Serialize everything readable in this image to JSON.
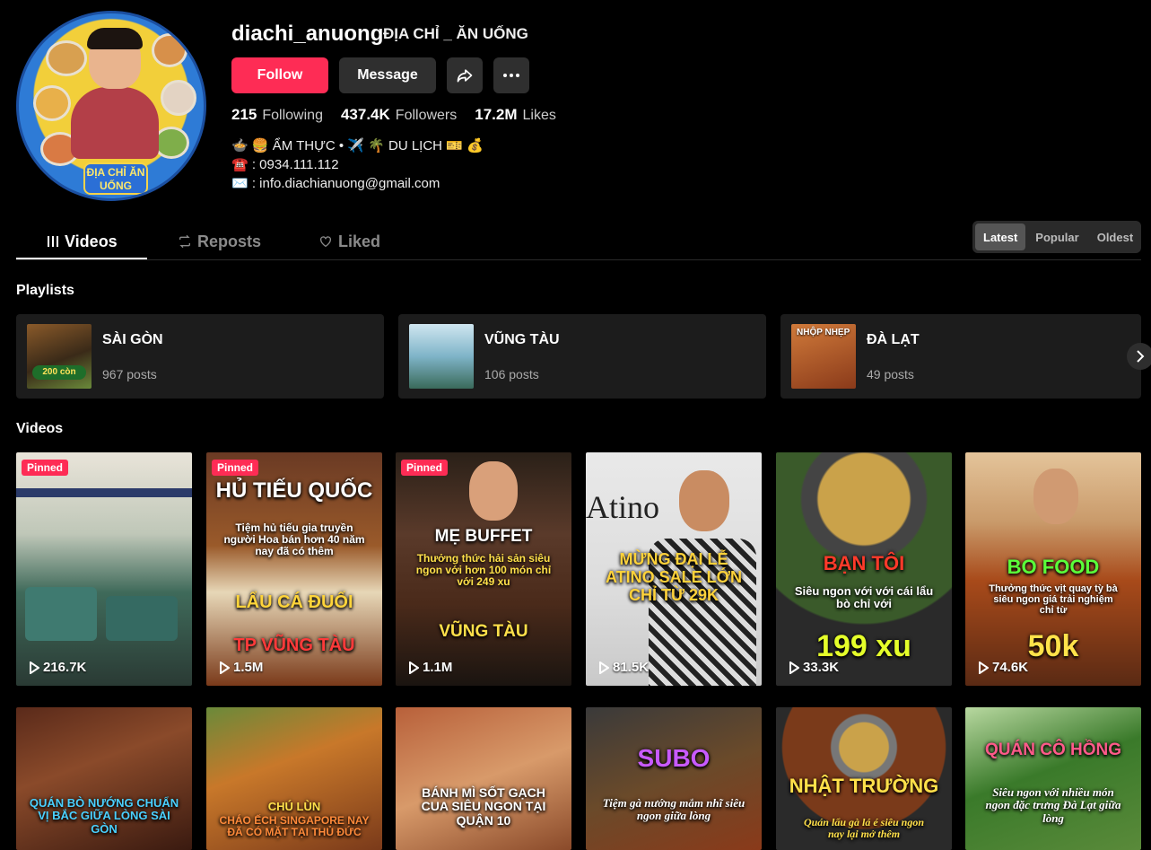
{
  "profile": {
    "username": "diachi_anuong",
    "nickname": "ĐỊA CHỈ _ ĂN UỐNG",
    "avatar_text": "ĐỊA CHỈ ĂN UỐNG",
    "follow_label": "Follow",
    "message_label": "Message",
    "share_icon": "share-icon",
    "more_icon": "more-icon"
  },
  "stats": {
    "following_value": "215",
    "following_label": "Following",
    "followers_value": "437.4K",
    "followers_label": "Followers",
    "likes_value": "17.2M",
    "likes_label": "Likes"
  },
  "bio": {
    "line1": "🍲 🍔 ẨM THỰC • ✈️ 🌴 DU LỊCH 🎫 💰",
    "line2": "☎️ : 0934.111.112",
    "line3": "✉️ : info.diachianuong@gmail.com"
  },
  "tabs": {
    "videos": "Videos",
    "reposts": "Reposts",
    "liked": "Liked"
  },
  "sort": {
    "latest": "Latest",
    "popular": "Popular",
    "oldest": "Oldest"
  },
  "sections": {
    "playlists": "Playlists",
    "videos": "Videos"
  },
  "playlists": [
    {
      "name": "SÀI GÒN",
      "count": "967 posts",
      "thumb_text": "200 còn"
    },
    {
      "name": "VŨNG TÀU",
      "count": "106 posts",
      "thumb_text": ""
    },
    {
      "name": "ĐÀ LẠT",
      "count": "49 posts",
      "thumb_text": "NHỘP NHẸP"
    }
  ],
  "videos_row1": [
    {
      "pinned": "Pinned",
      "views": "216.7K",
      "caption": ""
    },
    {
      "pinned": "Pinned",
      "views": "1.5M",
      "caption": "HỦ TIẾU QUỐC",
      "caption2": "Tiệm hủ tiếu gia truyền người Hoa bán hơn 40 năm nay đã có thêm",
      "caption3": "LẨU CÁ ĐUỐI",
      "caption4": "TP VŨNG TÀU"
    },
    {
      "pinned": "Pinned",
      "views": "1.1M",
      "caption": "MẸ BUFFET",
      "caption2": "Thưởng thức hải sản siêu ngon với hơn 100 món chỉ với 249 xu",
      "caption3": "VŨNG TÀU"
    },
    {
      "views": "81.5K",
      "caption": "MỪNG ĐẠI LỄ ATINO SALE LỚN CHỈ TỪ 29K",
      "brand": "Atino"
    },
    {
      "views": "33.3K",
      "caption": "BẠN TÔI",
      "caption2": "Siêu ngon với với cái lẩu bò chỉ với",
      "caption3": "199 xu"
    },
    {
      "views": "74.6K",
      "caption": "BO FOOD",
      "caption2": "Thưởng thức vịt quay tỳ bà siêu ngon giá trải nghiệm chỉ từ",
      "caption3": "50k"
    }
  ],
  "videos_row2": [
    {
      "caption": "QUÁN BÒ NƯỚNG CHUẨN VỊ BẮC GIỮA LÒNG SÀI GÒN"
    },
    {
      "caption": "CHÚ LÙN",
      "caption2": "CHÁO ẾCH SINGAPORE NAY ĐÃ CÓ MẶT TẠI THỦ ĐỨC"
    },
    {
      "caption": "BÁNH MÌ SỐT GẠCH CUA SIÊU NGON TẠI QUẬN 10"
    },
    {
      "caption": "SUBO",
      "caption2": "Tiệm gà nướng mắm nhĩ siêu ngon giữa lòng"
    },
    {
      "caption": "NHẬT TRƯỜNG",
      "caption2": "Quán lẩu gà lá é siêu ngon nay lại mở thêm"
    },
    {
      "caption": "QUÁN CÔ HỒNG",
      "caption2": "Siêu ngon với nhiều món ngon đặc trưng Đà Lạt giữa lòng"
    }
  ],
  "colors": {
    "accent": "#fe2c55",
    "background": "#000000",
    "surface": "#1c1c1c"
  }
}
